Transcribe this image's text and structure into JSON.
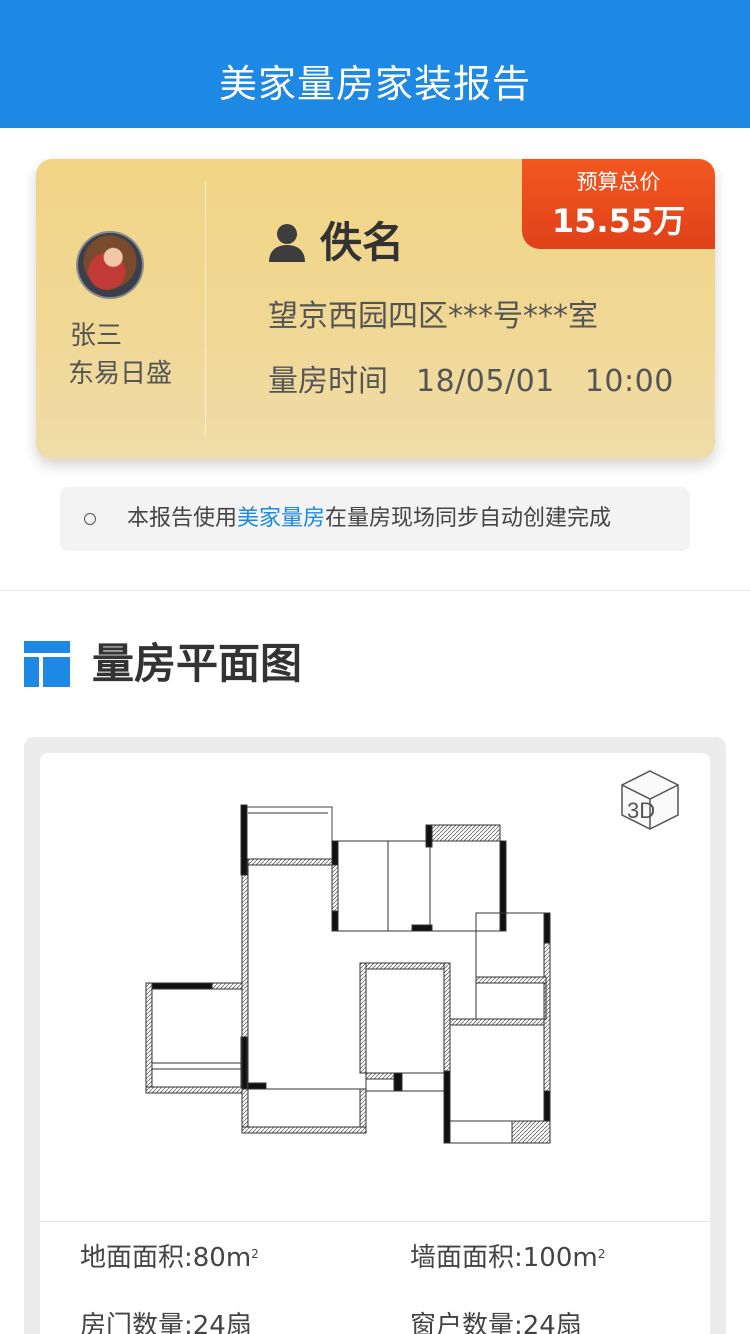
{
  "header": {
    "title": "美家量房家装报告"
  },
  "designer": {
    "name": "张三",
    "company": "东易日盛"
  },
  "client": {
    "name": "佚名",
    "address": "望京西园四区***号***室",
    "time_label": "量房时间",
    "time_value": "18/05/01   10:00"
  },
  "budget": {
    "label": "预算总价",
    "value": "15.55万"
  },
  "notice": {
    "prefix": "本报告使用",
    "brand": "美家量房",
    "suffix": "在量房现场同步自动创建完成"
  },
  "section": {
    "title": "量房平面图"
  },
  "plan": {
    "view_3d_label": "3D",
    "stats": [
      {
        "label": "地面面积:80m",
        "unit_sup": "2"
      },
      {
        "label": "墙面面积:100m",
        "unit_sup": "2"
      },
      {
        "label": "房门数量:24扇"
      },
      {
        "label": "窗户数量:24扇"
      }
    ]
  },
  "colors": {
    "primary": "#1e88e5",
    "budget": "#e8491c",
    "card_gold": "#f0d690"
  }
}
